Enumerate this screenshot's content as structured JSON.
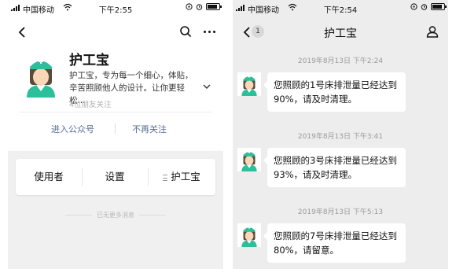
{
  "status_left": {
    "carrier": "中国移动",
    "time": "下午2:55"
  },
  "status_right": {
    "carrier": "中国移动",
    "time": "下午2:54"
  },
  "profile": {
    "name": "护工宝",
    "description": "护工宝，专为每一个细心，体贴，辛苦照顾他人的设计。让你更轻松...",
    "followers": "4位朋友关注",
    "action_enter": "进入公众号",
    "action_unfollow": "不再关注"
  },
  "menu": {
    "items": [
      "使用者",
      "设置",
      "护工宝"
    ]
  },
  "no_more": "已无更多消息",
  "chat": {
    "unread_badge": "1",
    "title": "护工宝",
    "messages": [
      {
        "time": "2019年8月13日 下午2:24",
        "text": "您照顾的1号床排泄量已经达到90%，请及时清理。"
      },
      {
        "time": "2019年8月13日 下午3:41",
        "text": "您照顾的3号床排泄量已经达到93%，请及时清理。"
      },
      {
        "time": "2019年8月13日 下午5:13",
        "text": "您照顾的7号床排泄量已经达到80%，请留意。"
      }
    ]
  },
  "icons": {
    "back": "chevron-left-icon",
    "search": "search-icon",
    "more": "more-dots-icon",
    "user": "user-icon",
    "expand": "chevron-down-icon",
    "avatar": "nurse-avatar"
  },
  "colors": {
    "link": "#576b95",
    "accent": "#2bbf9a",
    "bg": "#ededed"
  }
}
